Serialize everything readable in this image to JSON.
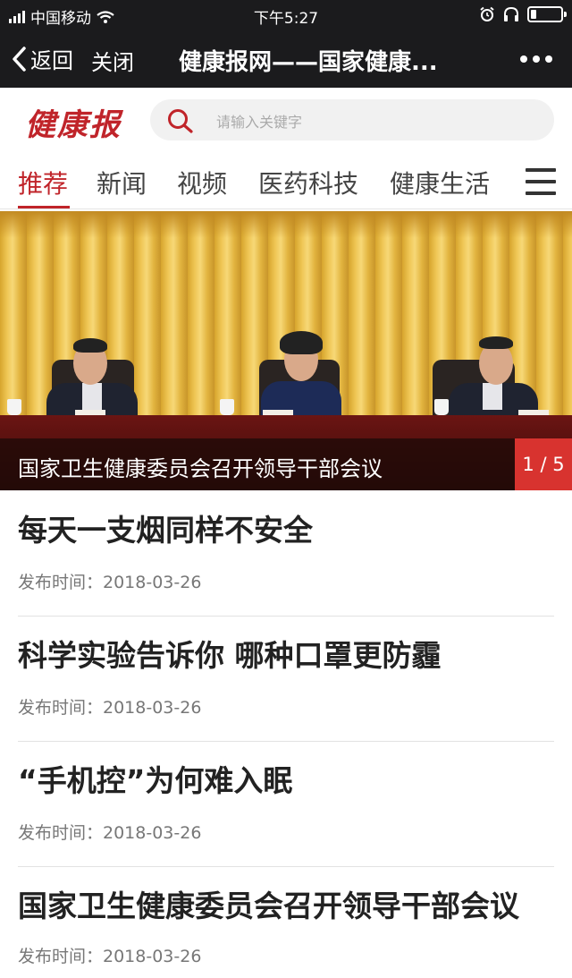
{
  "status_bar": {
    "carrier": "中国移动",
    "time": "下午5:27",
    "battery_level": 0.18
  },
  "nav": {
    "back_label": "返回",
    "close_label": "关闭",
    "title": "健康报网——国家健康..."
  },
  "header": {
    "logo_text": "健康报",
    "search_placeholder": "请输入关键字"
  },
  "tabs": [
    {
      "label": "推荐",
      "active": true
    },
    {
      "label": "新闻",
      "active": false
    },
    {
      "label": "视频",
      "active": false
    },
    {
      "label": "医药科技",
      "active": false
    },
    {
      "label": "健康生活",
      "active": false
    }
  ],
  "banner": {
    "caption": "国家卫生健康委员会召开领导干部会议",
    "pager": "1 / 5"
  },
  "articles": [
    {
      "title": "每天一支烟同样不安全",
      "meta": "发布时间：2018-03-26"
    },
    {
      "title": "科学实验告诉你 哪种口罩更防霾",
      "meta": "发布时间：2018-03-26"
    },
    {
      "title": "“手机控”为何难入眠",
      "meta": "发布时间：2018-03-26"
    },
    {
      "title": "国家卫生健康委员会召开领导干部会议",
      "meta": "发布时间：2018-03-26"
    }
  ],
  "colors": {
    "brand_red": "#c0242a",
    "nav_bg": "#1b1b1d",
    "pager_red": "#d8332f"
  },
  "icons": {
    "back": "chevron-left-icon",
    "more": "more-dots-icon",
    "search": "search-icon",
    "menu": "hamburger-menu-icon",
    "wifi": "wifi-icon",
    "alarm": "alarm-icon",
    "headphones": "headphones-icon",
    "battery": "battery-icon"
  }
}
